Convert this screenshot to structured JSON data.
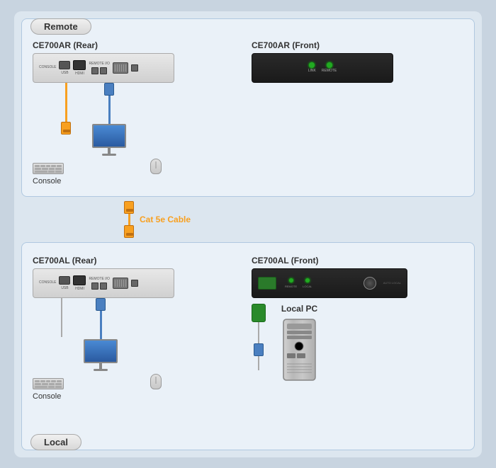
{
  "remote_badge": "Remote",
  "local_badge": "Local",
  "remote_rear_label": "CE700AR (Rear)",
  "remote_front_label": "CE700AR (Front)",
  "local_rear_label": "CE700AL (Rear)",
  "local_front_label": "CE700AL (Front)",
  "console_label": "Console",
  "local_pc_label": "Local PC",
  "cat5_label": "Cat 5e Cable",
  "colors": {
    "orange": "#f8a020",
    "blue": "#4a7fc0",
    "green": "#2a8a2a",
    "led_green": "#44ff44",
    "dark_bg": "#1a1a1a"
  }
}
